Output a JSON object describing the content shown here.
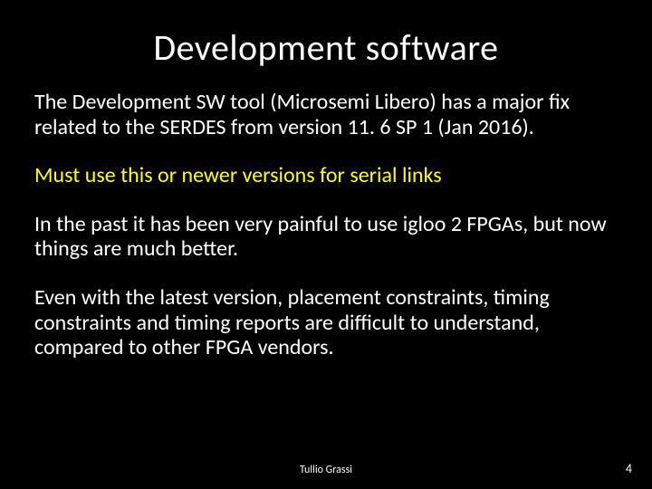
{
  "title": "Development software",
  "paragraphs": {
    "p1": "The Development SW tool (Microsemi Libero) has a major fix related to the SERDES from version 11. 6  SP 1 (Jan 2016).",
    "p2": "Must use this or newer versions for serial links",
    "p3": "In the past it has been very painful to use igloo 2 FPGAs, but now things are much better.",
    "p4": "Even with the latest version, placement constraints, timing constraints and timing reports are difficult to understand, compared to other FPGA vendors."
  },
  "footer": {
    "author": "Tullio Grassi",
    "page": "4"
  }
}
